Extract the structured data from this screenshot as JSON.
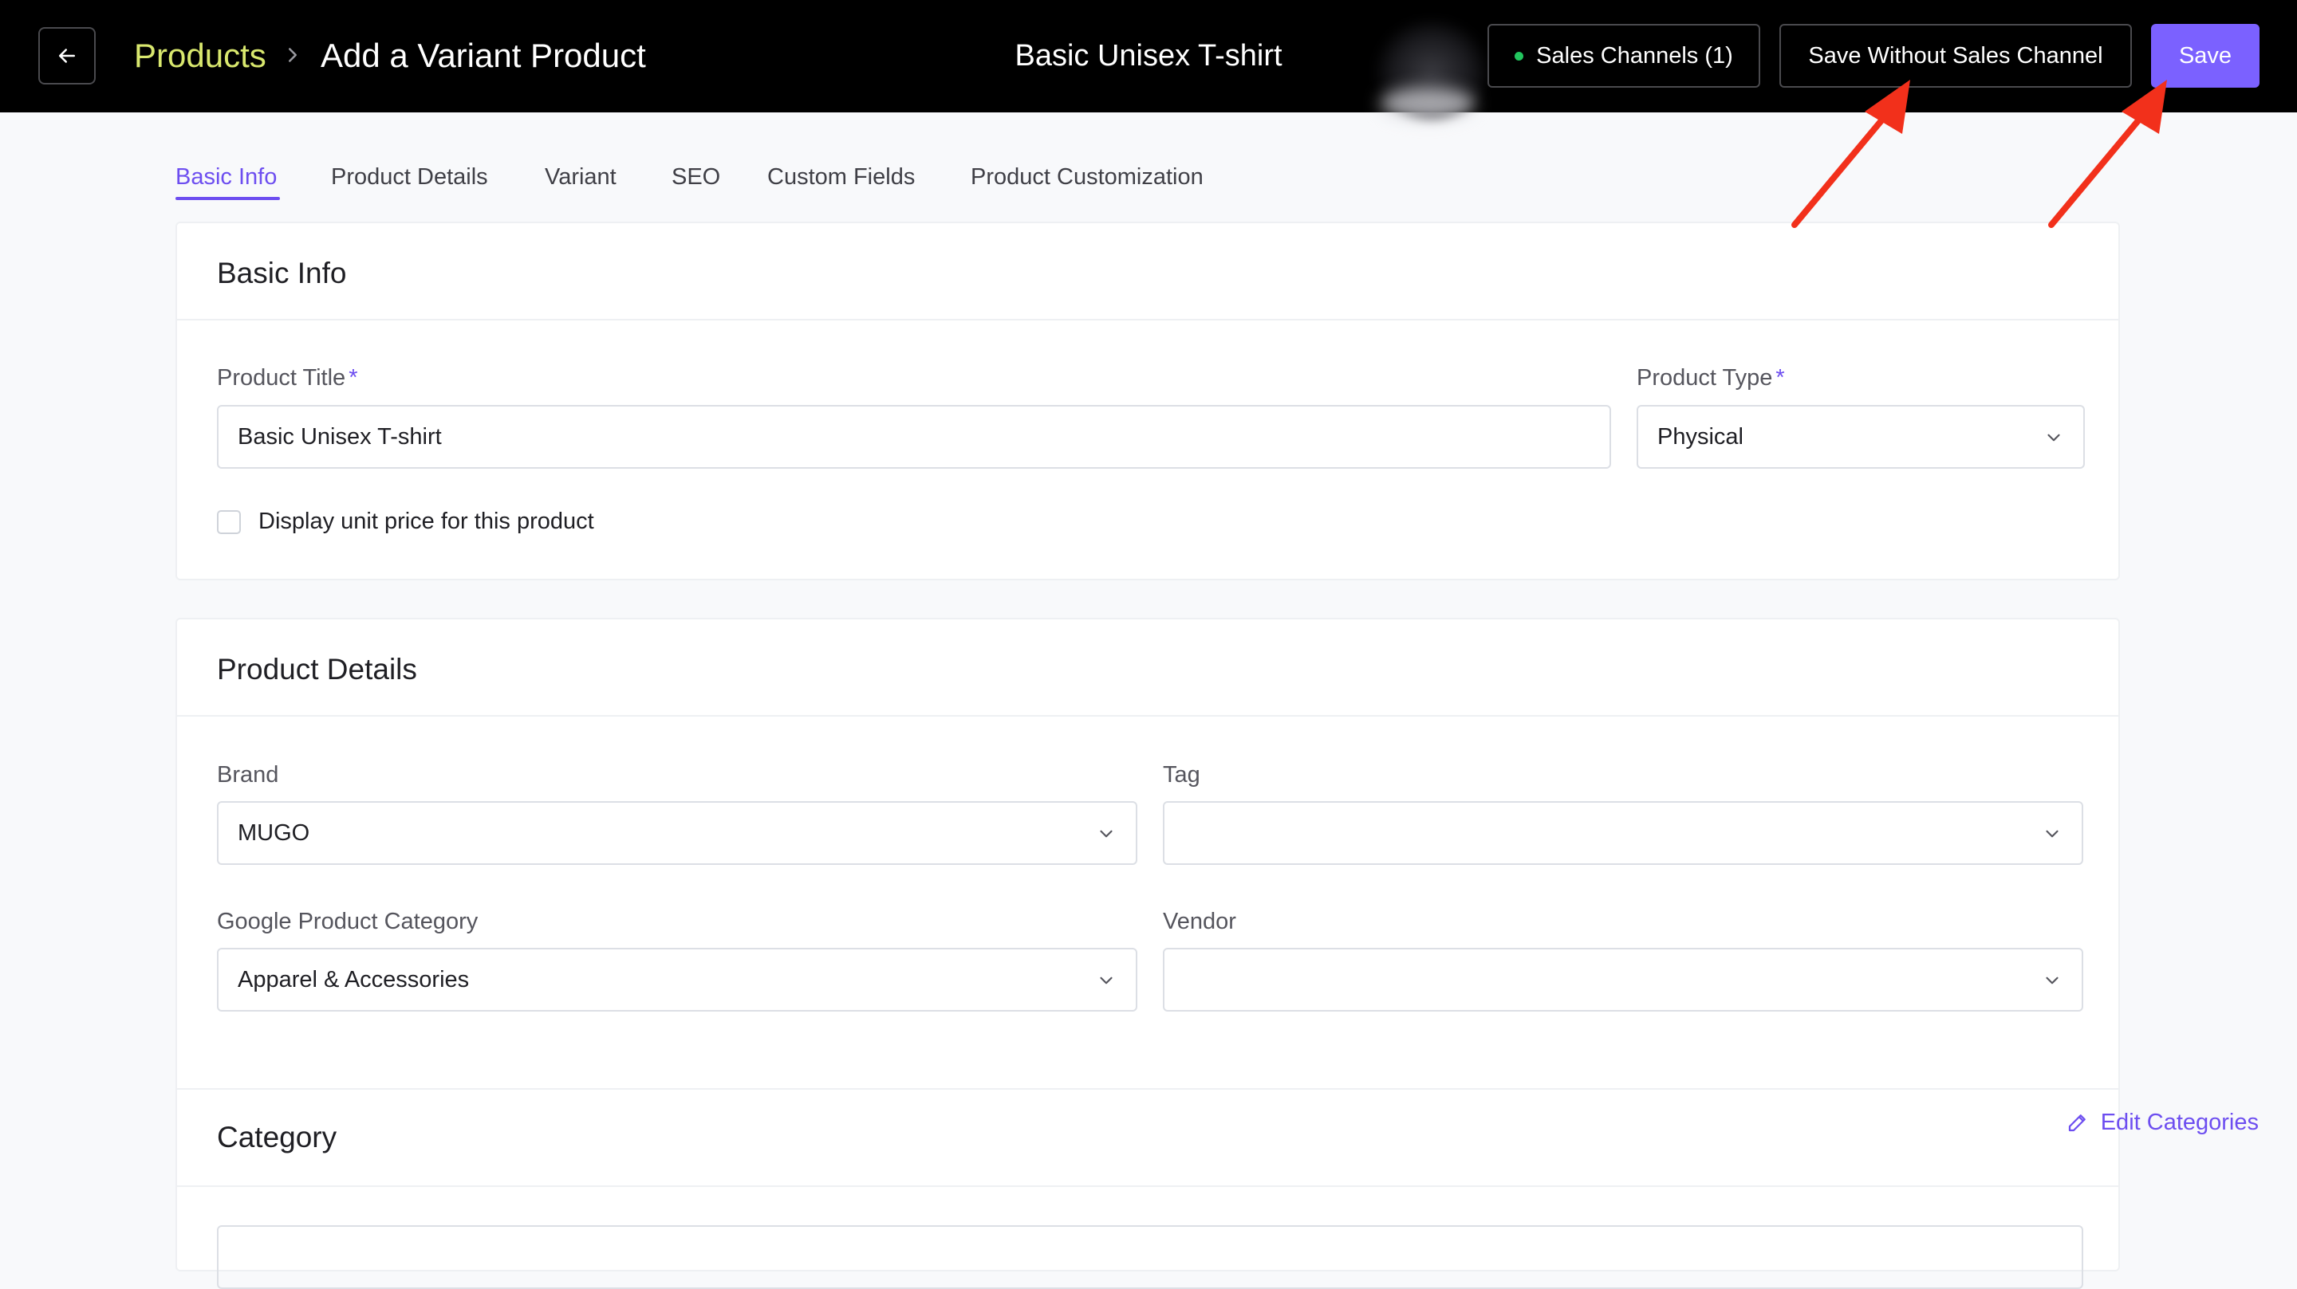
{
  "header": {
    "breadcrumb_parent": "Products",
    "breadcrumb_current": "Add a Variant Product",
    "product_name": "Basic Unisex T-shirt",
    "sales_channels_label": "Sales Channels (1)",
    "save_without_label": "Save Without Sales Channel",
    "save_label": "Save"
  },
  "tabs": [
    {
      "label": "Basic Info",
      "active": true
    },
    {
      "label": "Product Details",
      "active": false
    },
    {
      "label": "Variant",
      "active": false
    },
    {
      "label": "SEO",
      "active": false
    },
    {
      "label": "Custom Fields",
      "active": false
    },
    {
      "label": "Product Customization",
      "active": false
    }
  ],
  "basic_info": {
    "title": "Basic Info",
    "product_title_label": "Product Title",
    "product_title_value": "Basic Unisex T-shirt",
    "product_type_label": "Product Type",
    "product_type_value": "Physical",
    "required_mark": "*",
    "unit_price_label": "Display unit price for this product"
  },
  "product_details": {
    "title": "Product Details",
    "brand_label": "Brand",
    "brand_value": "MUGO",
    "tag_label": "Tag",
    "tag_value": "",
    "google_category_label": "Google Product Category",
    "google_category_value": "Apparel & Accessories",
    "vendor_label": "Vendor",
    "vendor_value": ""
  },
  "category": {
    "title": "Category",
    "edit_label": "Edit Categories"
  },
  "colors": {
    "accent": "#7b61ff",
    "breadcrumb": "#d9e86e",
    "annotation": "#f2301b",
    "status_dot": "#22c55e"
  },
  "icons": {
    "back": "arrow-left-icon",
    "separator": "chevron-right-icon",
    "dropdown": "chevron-down-icon",
    "edit": "pencil-icon"
  }
}
